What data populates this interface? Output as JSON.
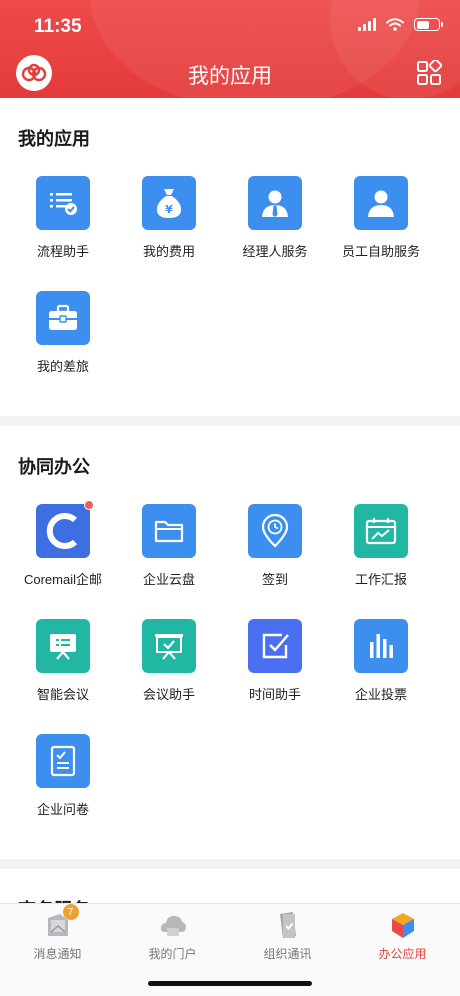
{
  "status_bar": {
    "time": "11:35"
  },
  "header": {
    "title": "我的应用"
  },
  "sections": [
    {
      "title": "我的应用",
      "apps": [
        {
          "label": "流程助手",
          "icon": "process-checklist-icon",
          "color": "#3d8fef"
        },
        {
          "label": "我的费用",
          "icon": "money-bag-icon",
          "color": "#3d8fef"
        },
        {
          "label": "经理人服务",
          "icon": "manager-person-icon",
          "color": "#3d8fef"
        },
        {
          "label": "员工自助服务",
          "icon": "employee-person-icon",
          "color": "#3d8fef"
        },
        {
          "label": "我的差旅",
          "icon": "briefcase-icon",
          "color": "#3d8fef"
        }
      ]
    },
    {
      "title": "协同办公",
      "apps": [
        {
          "label": "Coremail企邮",
          "icon": "coremail-icon",
          "color": "#3e6fe2",
          "dot": true
        },
        {
          "label": "企业云盘",
          "icon": "folder-icon",
          "color": "#3d8fef"
        },
        {
          "label": "签到",
          "icon": "location-clock-icon",
          "color": "#3d8fef"
        },
        {
          "label": "工作汇报",
          "icon": "report-chart-icon",
          "color": "#22b7a3"
        },
        {
          "label": "智能会议",
          "icon": "meeting-board-icon",
          "color": "#22b7a3"
        },
        {
          "label": "会议助手",
          "icon": "presentation-icon",
          "color": "#22b7a3"
        },
        {
          "label": "时间助手",
          "icon": "time-check-icon",
          "color": "#4a6ff0"
        },
        {
          "label": "企业投票",
          "icon": "vote-bars-icon",
          "color": "#3d8fef"
        },
        {
          "label": "企业问卷",
          "icon": "questionnaire-icon",
          "color": "#3d8fef"
        }
      ]
    },
    {
      "title": "商务服务",
      "apps": []
    }
  ],
  "tabbar": {
    "items": [
      {
        "label": "消息通知",
        "icon": "message-bell-icon",
        "badge": "7",
        "active": false
      },
      {
        "label": "我的门户",
        "icon": "portal-cloud-icon",
        "active": false
      },
      {
        "label": "组织通讯",
        "icon": "contacts-book-icon",
        "active": false
      },
      {
        "label": "办公应用",
        "icon": "office-cube-icon",
        "active": true
      }
    ]
  },
  "colors": {
    "brand_red": "#e53e3e",
    "icon_blue": "#3d8fef",
    "icon_teal": "#22b7a3"
  }
}
